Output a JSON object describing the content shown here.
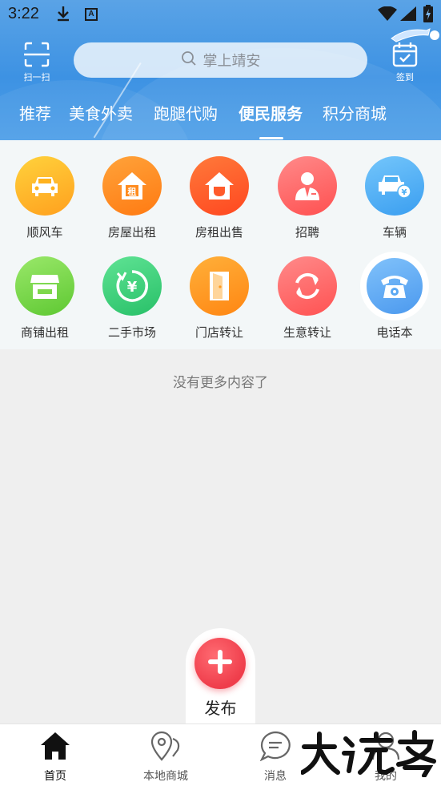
{
  "status_bar": {
    "time": "3:22",
    "download_icon": "download-icon",
    "app_icon_letter": "A"
  },
  "header": {
    "scan_label": "扫一扫",
    "search_placeholder": "掌上靖安",
    "sign_label": "签到",
    "tabs": [
      "推荐",
      "美食外卖",
      "跑腿代购",
      "便民服务",
      "积分商城"
    ],
    "active_tab": "便民服务",
    "bg_color": "#4a9ae6"
  },
  "services": [
    {
      "label": "顺风车",
      "icon": "car-icon",
      "color": "#ffb21e"
    },
    {
      "label": "房屋出租",
      "icon": "house-rent-icon",
      "color": "#ff8b1e"
    },
    {
      "label": "房租出售",
      "icon": "house-sale-icon",
      "color": "#ff5a2a"
    },
    {
      "label": "招聘",
      "icon": "recruit-person-icon",
      "color": "#ff6868"
    },
    {
      "label": "车辆",
      "icon": "vehicle-yuan-icon",
      "color": "#4eb0f3"
    },
    {
      "label": "商铺出租",
      "icon": "shop-icon",
      "color": "#7ed84b"
    },
    {
      "label": "二手市场",
      "icon": "yuan-cycle-icon",
      "color": "#3ed27e"
    },
    {
      "label": "门店转让",
      "icon": "door-icon",
      "color": "#ff9a1e"
    },
    {
      "label": "生意转让",
      "icon": "transfer-cycle-icon",
      "color": "#ff6a6a"
    },
    {
      "label": "电话本",
      "icon": "phone-icon",
      "color": "#5aa8f3"
    }
  ],
  "no_more_text": "没有更多内容了",
  "publish": {
    "label": "发布",
    "color": "#ef3d4b"
  },
  "bottom_nav": [
    {
      "label": "首页",
      "icon": "home-icon",
      "active": true
    },
    {
      "label": "本地商城",
      "icon": "map-pin-icon",
      "active": false
    },
    {
      "label": "消息",
      "icon": "chat-icon",
      "active": false
    },
    {
      "label": "我的",
      "icon": "profile-icon",
      "active": false
    }
  ]
}
